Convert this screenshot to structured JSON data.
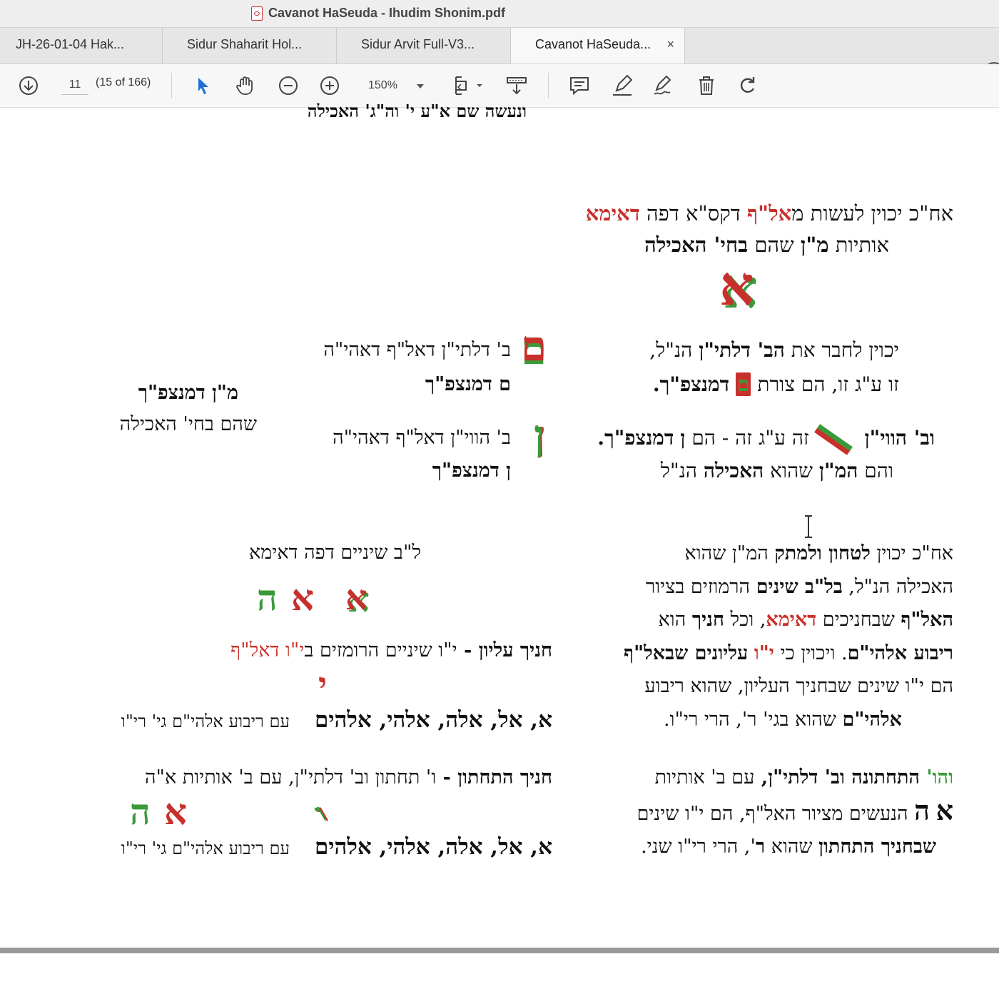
{
  "window": {
    "title": "Cavanot HaSeuda - Ihudim Shonim.pdf"
  },
  "tabs": [
    {
      "label": "JH-26-01-04 Hak..."
    },
    {
      "label": "Sidur Shaharit Hol..."
    },
    {
      "label": "Sidur Arvit Full-V3..."
    },
    {
      "label": "Cavanot HaSeuda...",
      "close": "×"
    }
  ],
  "toolbar": {
    "help": "?",
    "page_number": "11",
    "page_count": "(15 of 166)",
    "zoom": "150%",
    "icons": [
      "download-icon",
      "select-arrow-icon",
      "hand-icon",
      "zoom-out-icon",
      "zoom-in-icon",
      "page-fit-icon",
      "rotate-view-icon",
      "comment-icon",
      "highlight-icon",
      "sign-icon",
      "delete-icon",
      "rotate-icon"
    ]
  },
  "colors": {
    "red": "#c8302c",
    "green": "#3a9a3a",
    "text": "#111111"
  },
  "doc": {
    "top_cut": "ונעשה שם א\"ע י' וה\"ג' האכילה",
    "intro": {
      "l1a": "אח\"כ יכוין לעשות מ",
      "l1b": "אל\"ף",
      "l1c": " דקס\"א דפה ",
      "l1d": "דאימא",
      "l2a": "אותיות ",
      "l2b": "מ\"ן",
      "l2c": " שהם ",
      "l2d": "בחי' האכילה"
    },
    "big_alef": "א",
    "rc1": {
      "l1a": "יכוין לחבר את ",
      "l1b": "הב' דלתי\"ן",
      "l1c": " הנ\"ל,",
      "l2a": "זו ע\"ג זו, הם צורת ",
      "l2b": "ם",
      "l2c": " ",
      "l2d": "דמנצפ\"ך."
    },
    "rc2": {
      "l1a": "וב' הווי\"ן ",
      "l1b": "זה ע\"ג זה - הם ",
      "l1c": "ן",
      "l1d": " ",
      "l1e": "דמנצפ\"ך.",
      "l2a": "והם ",
      "l2b": "המ\"ן",
      "l2c": " שהוא ",
      "l2d": "האכילה",
      "l2e": " הנ\"ל"
    },
    "mc1": {
      "l1": "ב' דלתי\"ן דאל\"ף דאהי\"ה",
      "l2": "ם דמנצפ\"ך",
      "glyph": "ם"
    },
    "mc2": {
      "l1": "ב' הווי\"ן דאל\"ף דאהי\"ה",
      "l2": "ן דמנצפ\"ך",
      "glyph": "ן"
    },
    "lc": {
      "l1": "מ\"ן דמנצפ\"ך",
      "l2": "שהם בחי' האכילה"
    },
    "para2": {
      "l1a": "אח\"כ יכוין ",
      "l1b": "לטחון ולמתק",
      "l1c": " המ\"ן שהוא",
      "l2a": "האכילה הנ\"ל, ",
      "l2b": "בל\"ב שינים",
      "l2c": " הרמוזים בציור",
      "l3a": "האל\"ף",
      "l3b": " שבחניכים ",
      "l3c": "דאימא",
      "l3d": ", וכל ",
      "l3e": "חניך",
      "l3f": " הוא",
      "l4a": "ריבוע אלהי\"ם",
      "l4b": ". ויכוין כי ",
      "l4c": "י\"ו",
      "l4d": " ",
      "l4e": "עליונים שבאל\"ף",
      "l5": "הם י\"ו שינים שבחניך העליון, שהוא ריבוע",
      "l6a": "אלהי\"ם",
      "l6b": " שהוא בגי' ר', הרי רי\"ו."
    },
    "m2": {
      "title": "ל\"ב שיניים דפה דאימא",
      "g1": "א",
      "g2": "א",
      "g3": "ה",
      "upper_a": "חניך עליון - ",
      "upper_b": "י\"ו שיניים הרומזים ב",
      "upper_c": "י\"ו דאל\"ף",
      "small_yud": "י",
      "names1": "א, אל, אלה, אלהי, אלהים",
      "ribua1": "עם ריבוע אלהי\"ם גי' רי\"ו",
      "lower_a": "חניך התחתון - ",
      "lower_b": "ו' תחתון וב' דלתי\"ן, עם ב' אותיות א\"ה",
      "g4": "ו",
      "g5": "א",
      "g6": "ה",
      "names2": "א, אל, אלה, אלהי, אלהים",
      "ribua2": "עם ריבוע אלהי\"ם גי' רי\"ו"
    },
    "para3": {
      "l1a": "והו'",
      "l1b": " התחתונה וב' דלתי\"ן, ",
      "l1c": "עם ב' אותיות",
      "l2a": "א",
      "l2b": "ה",
      "l2c": " הנעשים מציור האל\"ף, הם י\"ו שינים",
      "l3a": "שבחניך התחתון",
      "l3b": " שהוא ",
      "l3c": "ר",
      "l3d": "', הרי רי\"ו שני."
    }
  }
}
